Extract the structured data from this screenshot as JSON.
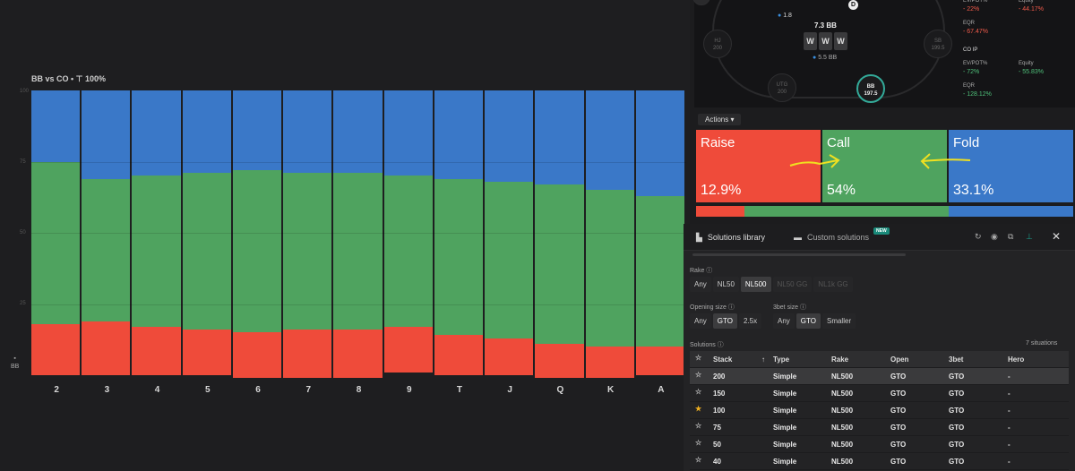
{
  "chart": {
    "header": "BB vs CO • ⊤ 100%",
    "bb_label": "BB",
    "yticks": [
      "100",
      "75",
      "50",
      "25"
    ]
  },
  "chart_data": {
    "type": "bar",
    "categories": [
      "2",
      "3",
      "4",
      "5",
      "6",
      "7",
      "8",
      "9",
      "T",
      "J",
      "Q",
      "K",
      "A"
    ],
    "series": [
      {
        "name": "Fold",
        "color": "#3a78c8",
        "values": [
          25,
          31,
          30,
          29,
          28,
          29,
          29,
          30,
          31,
          32,
          33,
          35,
          37
        ]
      },
      {
        "name": "Call",
        "color": "#4fa35f",
        "values": [
          57,
          50,
          53,
          55,
          57,
          55,
          55,
          53,
          55,
          55,
          56,
          55,
          53
        ]
      },
      {
        "name": "Raise",
        "color": "#ef4b3a",
        "values": [
          18,
          19,
          17,
          16,
          16,
          17,
          17,
          16,
          14,
          13,
          12,
          11,
          10
        ]
      }
    ],
    "ylim": [
      0,
      100
    ]
  },
  "table": {
    "pot": "7.3 BB",
    "pot_sub": "5.5 BB",
    "chip_value": "1.8",
    "board_cards": [
      "W",
      "W",
      "W"
    ],
    "seats": [
      {
        "name": "HJ",
        "stack": "200"
      },
      {
        "name": "SB",
        "stack": "199.5"
      },
      {
        "name": "UTG",
        "stack": "200"
      },
      {
        "name": "BB",
        "stack": "197.5"
      }
    ],
    "dealer": "D"
  },
  "stats": {
    "evpot_label": "EV/POT%",
    "evpot_top": "- 22%",
    "equity_label": "Equity",
    "equity_top": "- 44.17%",
    "eqr_label": "EQR",
    "eqr_top": "- 67.47%",
    "position_label": "CO  IP",
    "evpot_co": "- 72%",
    "equity_co": "- 55.83%",
    "eqr_co": "- 128.12%"
  },
  "actions": {
    "button_label": "Actions",
    "tiles": [
      {
        "name": "Raise",
        "pct": "12.9%",
        "color": "#ef4b3a"
      },
      {
        "name": "Call",
        "pct": "54%",
        "color": "#4fa35f"
      },
      {
        "name": "Fold",
        "pct": "33.1%",
        "color": "#3a78c8"
      }
    ],
    "freq": [
      12.9,
      54,
      33.1
    ]
  },
  "library": {
    "tab_library": "Solutions library",
    "tab_custom": "Custom solutions",
    "new_badge": "NEW",
    "rake_label": "Rake",
    "rake_options": [
      "Any",
      "NL50",
      "NL500",
      "NL50 GG",
      "NL1k GG"
    ],
    "opening_label": "Opening size",
    "opening_options": [
      "Any",
      "GTO",
      "2.5x"
    ],
    "threebet_label": "3bet size",
    "threebet_options": [
      "Any",
      "GTO",
      "Smaller"
    ],
    "solutions_label": "Solutions",
    "situations_count": "7 situations",
    "columns": [
      "Stack",
      "Type",
      "Rake",
      "Open",
      "3bet",
      "Hero"
    ],
    "rows": [
      {
        "stack": "200",
        "type": "Simple",
        "rake": "NL500",
        "open": "GTO",
        "threebet": "GTO",
        "hero": "-",
        "starred": false
      },
      {
        "stack": "150",
        "type": "Simple",
        "rake": "NL500",
        "open": "GTO",
        "threebet": "GTO",
        "hero": "-",
        "starred": false
      },
      {
        "stack": "100",
        "type": "Simple",
        "rake": "NL500",
        "open": "GTO",
        "threebet": "GTO",
        "hero": "-",
        "starred": true
      },
      {
        "stack": "75",
        "type": "Simple",
        "rake": "NL500",
        "open": "GTO",
        "threebet": "GTO",
        "hero": "-",
        "starred": false
      },
      {
        "stack": "50",
        "type": "Simple",
        "rake": "NL500",
        "open": "GTO",
        "threebet": "GTO",
        "hero": "-",
        "starred": false
      },
      {
        "stack": "40",
        "type": "Simple",
        "rake": "NL500",
        "open": "GTO",
        "threebet": "GTO",
        "hero": "-",
        "starred": false
      }
    ]
  }
}
